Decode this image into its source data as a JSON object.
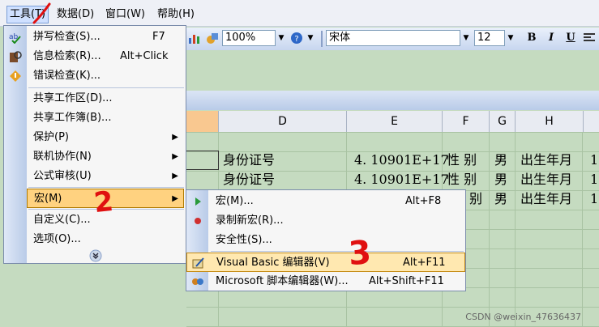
{
  "menubar": {
    "items": [
      {
        "label": "工具(T)"
      },
      {
        "label": "数据(D)"
      },
      {
        "label": "窗口(W)"
      },
      {
        "label": "帮助(H)"
      }
    ]
  },
  "toolbar": {
    "zoom": "100%",
    "font": "宋体",
    "size": "12",
    "bold": "B",
    "italic": "I",
    "underline": "U"
  },
  "sheet": {
    "columns": [
      "D",
      "E",
      "F",
      "G",
      "H"
    ],
    "rows": [
      {
        "d": "身份证号",
        "e": "4. 10901E+17",
        "f": "性 别",
        "g": "男",
        "h": "出生年月",
        "i": "1"
      },
      {
        "d": "身份证号",
        "e": "4. 10901E+17",
        "f": "性 别",
        "g": "男",
        "h": "出生年月",
        "i": "1"
      },
      {
        "d": "",
        "e": "",
        "f": "别",
        "g": "男",
        "h": "出生年月",
        "i": "1"
      }
    ]
  },
  "tools_menu": {
    "items": [
      {
        "label": "拼写检查(S)...",
        "shortcut": "F7",
        "icon": "spellcheck-icon"
      },
      {
        "label": "信息检索(R)...",
        "shortcut": "Alt+Click",
        "icon": "research-icon"
      },
      {
        "label": "错误检查(K)...",
        "shortcut": "",
        "icon": "error-check-icon"
      },
      {
        "label": "共享工作区(D)...",
        "shortcut": ""
      },
      {
        "label": "共享工作簿(B)...",
        "shortcut": ""
      },
      {
        "label": "保护(P)",
        "shortcut": "",
        "submenu": true
      },
      {
        "label": "联机协作(N)",
        "shortcut": "",
        "submenu": true
      },
      {
        "label": "公式审核(U)",
        "shortcut": "",
        "submenu": true
      },
      {
        "label": "宏(M)",
        "shortcut": "",
        "submenu": true,
        "highlighted": true
      },
      {
        "label": "自定义(C)...",
        "shortcut": ""
      },
      {
        "label": "选项(O)...",
        "shortcut": ""
      }
    ],
    "expand_icon": "chevron-double-down-icon"
  },
  "macro_menu": {
    "items": [
      {
        "label": "宏(M)...",
        "shortcut": "Alt+F8",
        "icon": "play-icon"
      },
      {
        "label": "录制新宏(R)...",
        "shortcut": "",
        "icon": "record-icon"
      },
      {
        "label": "安全性(S)...",
        "shortcut": ""
      },
      {
        "label": "Visual Basic 编辑器(V)",
        "shortcut": "Alt+F11",
        "icon": "vb-editor-icon",
        "highlighted": true
      },
      {
        "label": "Microsoft 脚本编辑器(W)...",
        "shortcut": "Alt+Shift+F11",
        "icon": "script-editor-icon"
      }
    ]
  },
  "annotations": [
    "2",
    "3"
  ],
  "watermark": "CSDN @weixin_47636437",
  "colors": {
    "highlight": "#ffd280",
    "grid": "#c5dbc0",
    "annotation": "#e01010"
  }
}
